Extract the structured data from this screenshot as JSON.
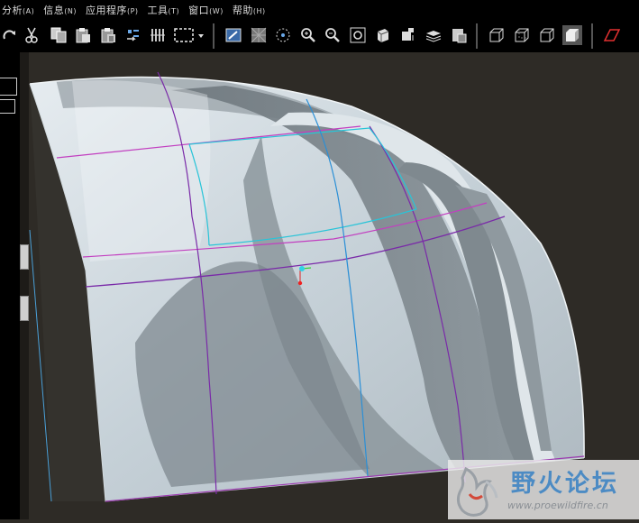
{
  "menu": [
    {
      "label": "分析",
      "key": "(A)"
    },
    {
      "label": "信息",
      "key": "(N)"
    },
    {
      "label": "应用程序",
      "key": "(P)"
    },
    {
      "label": "工具",
      "key": "(T)"
    },
    {
      "label": "窗口",
      "key": "(W)"
    },
    {
      "label": "帮助",
      "key": "(H)"
    }
  ],
  "toolbar_icons": [
    "redo-icon",
    "cut-icon",
    "copy-icon",
    "paste-icon",
    "paste-special-icon",
    "regenerate-icon",
    "selection-filter-icon",
    "box-select-icon",
    "dropdown-icon",
    "repaint-icon",
    "orient-icon",
    "spin-center-icon",
    "zoom-in-icon",
    "zoom-out-icon",
    "refit-icon",
    "saved-views-icon",
    "layers-icon",
    "model-tree-icon",
    "view-manager-icon",
    "wireframe-icon",
    "hidden-line-icon",
    "no-hidden-icon",
    "shading-icon",
    "datum-plane-icon"
  ],
  "watermark": {
    "brand": "野火论坛",
    "url": "www.proewildfire.cn"
  },
  "colors": {
    "background": "#2e2b26",
    "surface": "#c7d2da",
    "magenta_curve": "#c23fc0",
    "purple_curve": "#7a2aa8",
    "cyan_curve": "#29c4d8",
    "blue_curve": "#2b8fd6"
  }
}
